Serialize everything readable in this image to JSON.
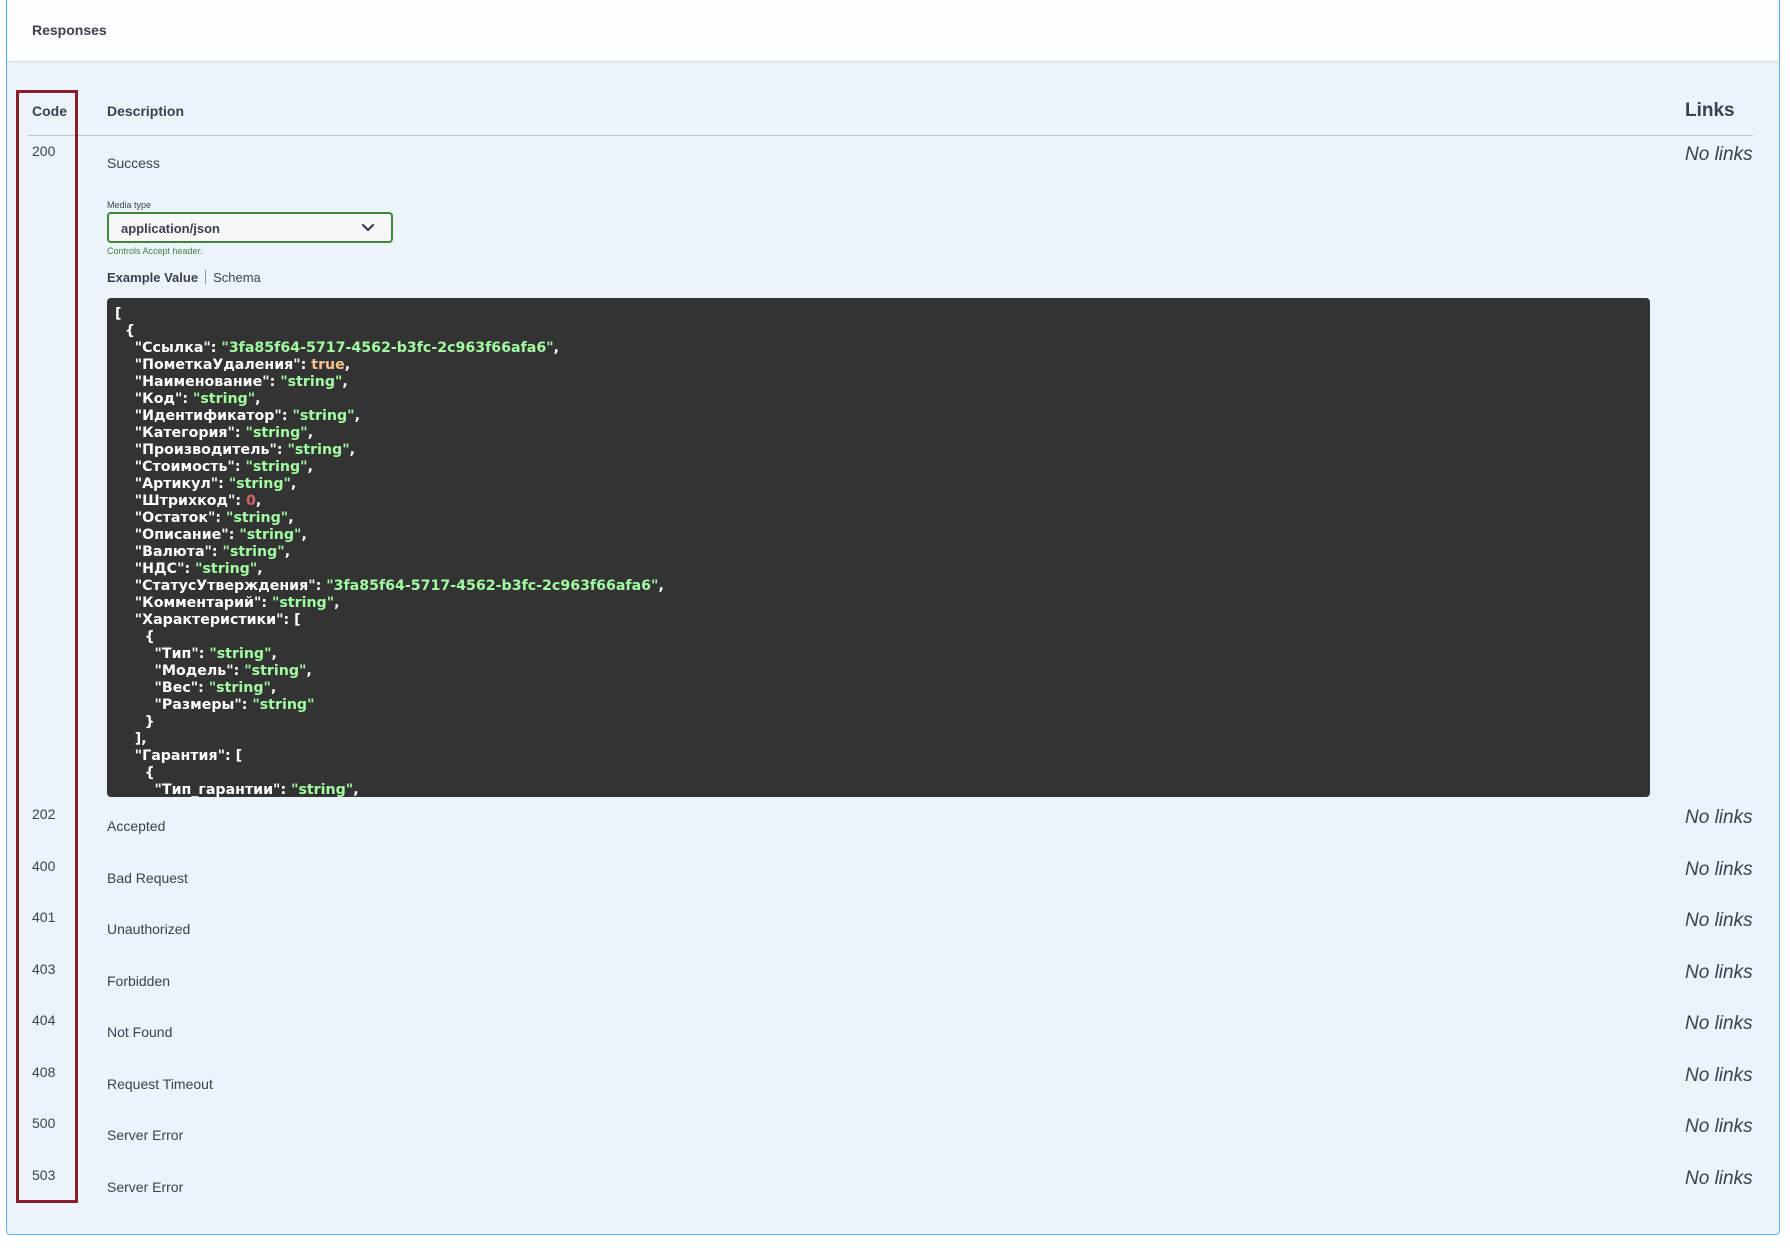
{
  "section": {
    "title": "Responses"
  },
  "columns": {
    "code": "Code",
    "description": "Description",
    "links": "Links"
  },
  "success": {
    "code": "200",
    "description": "Success",
    "links": "No links",
    "media_type_label": "Media type",
    "media_type_value": "application/json",
    "media_type_hint": "Controls Accept header.",
    "tabs": {
      "example": "Example Value",
      "schema": "Schema"
    },
    "example_lines": [
      [
        [
          "p",
          "["
        ]
      ],
      [
        [
          "p",
          "  {"
        ]
      ],
      [
        [
          "k",
          "    \"Ссылка\""
        ],
        [
          "p",
          ": "
        ],
        [
          "s",
          "\"3fa85f64-5717-4562-b3fc-2c963f66afa6\""
        ],
        [
          "p",
          ","
        ]
      ],
      [
        [
          "k",
          "    \"ПометкаУдаления\""
        ],
        [
          "p",
          ": "
        ],
        [
          "b",
          "true"
        ],
        [
          "p",
          ","
        ]
      ],
      [
        [
          "k",
          "    \"Наименование\""
        ],
        [
          "p",
          ": "
        ],
        [
          "s",
          "\"string\""
        ],
        [
          "p",
          ","
        ]
      ],
      [
        [
          "k",
          "    \"Код\""
        ],
        [
          "p",
          ": "
        ],
        [
          "s",
          "\"string\""
        ],
        [
          "p",
          ","
        ]
      ],
      [
        [
          "k",
          "    \"Идентификатор\""
        ],
        [
          "p",
          ": "
        ],
        [
          "s",
          "\"string\""
        ],
        [
          "p",
          ","
        ]
      ],
      [
        [
          "k",
          "    \"Категория\""
        ],
        [
          "p",
          ": "
        ],
        [
          "s",
          "\"string\""
        ],
        [
          "p",
          ","
        ]
      ],
      [
        [
          "k",
          "    \"Производитель\""
        ],
        [
          "p",
          ": "
        ],
        [
          "s",
          "\"string\""
        ],
        [
          "p",
          ","
        ]
      ],
      [
        [
          "k",
          "    \"Стоимость\""
        ],
        [
          "p",
          ": "
        ],
        [
          "s",
          "\"string\""
        ],
        [
          "p",
          ","
        ]
      ],
      [
        [
          "k",
          "    \"Артикул\""
        ],
        [
          "p",
          ": "
        ],
        [
          "s",
          "\"string\""
        ],
        [
          "p",
          ","
        ]
      ],
      [
        [
          "k",
          "    \"Штрихкод\""
        ],
        [
          "p",
          ": "
        ],
        [
          "n",
          "0"
        ],
        [
          "p",
          ","
        ]
      ],
      [
        [
          "k",
          "    \"Остаток\""
        ],
        [
          "p",
          ": "
        ],
        [
          "s",
          "\"string\""
        ],
        [
          "p",
          ","
        ]
      ],
      [
        [
          "k",
          "    \"Описание\""
        ],
        [
          "p",
          ": "
        ],
        [
          "s",
          "\"string\""
        ],
        [
          "p",
          ","
        ]
      ],
      [
        [
          "k",
          "    \"Валюта\""
        ],
        [
          "p",
          ": "
        ],
        [
          "s",
          "\"string\""
        ],
        [
          "p",
          ","
        ]
      ],
      [
        [
          "k",
          "    \"НДС\""
        ],
        [
          "p",
          ": "
        ],
        [
          "s",
          "\"string\""
        ],
        [
          "p",
          ","
        ]
      ],
      [
        [
          "k",
          "    \"СтатусУтверждения\""
        ],
        [
          "p",
          ": "
        ],
        [
          "s",
          "\"3fa85f64-5717-4562-b3fc-2c963f66afa6\""
        ],
        [
          "p",
          ","
        ]
      ],
      [
        [
          "k",
          "    \"Комментарий\""
        ],
        [
          "p",
          ": "
        ],
        [
          "s",
          "\"string\""
        ],
        [
          "p",
          ","
        ]
      ],
      [
        [
          "k",
          "    \"Характеристики\""
        ],
        [
          "p",
          ": ["
        ]
      ],
      [
        [
          "p",
          "      {"
        ]
      ],
      [
        [
          "k",
          "        \"Тип\""
        ],
        [
          "p",
          ": "
        ],
        [
          "s",
          "\"string\""
        ],
        [
          "p",
          ","
        ]
      ],
      [
        [
          "k",
          "        \"Модель\""
        ],
        [
          "p",
          ": "
        ],
        [
          "s",
          "\"string\""
        ],
        [
          "p",
          ","
        ]
      ],
      [
        [
          "k",
          "        \"Вес\""
        ],
        [
          "p",
          ": "
        ],
        [
          "s",
          "\"string\""
        ],
        [
          "p",
          ","
        ]
      ],
      [
        [
          "k",
          "        \"Размеры\""
        ],
        [
          "p",
          ": "
        ],
        [
          "s",
          "\"string\""
        ]
      ],
      [
        [
          "p",
          "      }"
        ]
      ],
      [
        [
          "p",
          "    ],"
        ]
      ],
      [
        [
          "k",
          "    \"Гарантия\""
        ],
        [
          "p",
          ": ["
        ]
      ],
      [
        [
          "p",
          "      {"
        ]
      ],
      [
        [
          "k",
          "        \"Тип_гарантии\""
        ],
        [
          "p",
          ": "
        ],
        [
          "s",
          "\"string\""
        ],
        [
          "p",
          ","
        ]
      ]
    ]
  },
  "responses": [
    {
      "code": "202",
      "description": "Accepted",
      "links": "No links"
    },
    {
      "code": "400",
      "description": "Bad Request",
      "links": "No links"
    },
    {
      "code": "401",
      "description": "Unauthorized",
      "links": "No links"
    },
    {
      "code": "403",
      "description": "Forbidden",
      "links": "No links"
    },
    {
      "code": "404",
      "description": "Not Found",
      "links": "No links"
    },
    {
      "code": "408",
      "description": "Request Timeout",
      "links": "No links"
    },
    {
      "code": "500",
      "description": "Server Error",
      "links": "No links"
    },
    {
      "code": "503",
      "description": "Server Error",
      "links": "No links"
    }
  ],
  "colors": {
    "panel_bg": "#ebf3fb",
    "highlight_border": "#8b1c2c",
    "select_border": "#41863f",
    "code_bg": "#333333",
    "json_string": "#a2fca2",
    "json_boolean": "#fcc28c",
    "json_number": "#d36363"
  }
}
